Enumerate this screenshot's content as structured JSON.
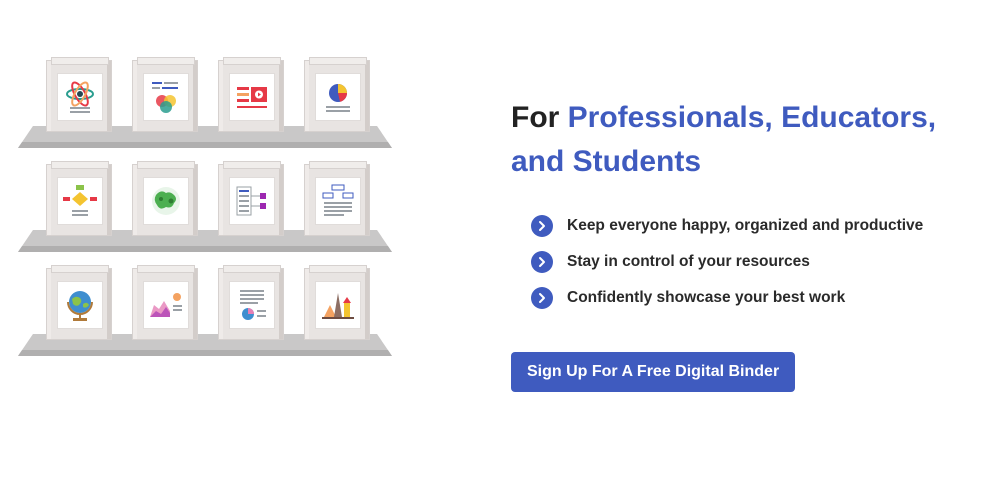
{
  "hero": {
    "headline_plain": "For",
    "headline_accent_1": "Professionals, Educators,",
    "headline_accent_2": "and Students",
    "bullets": [
      {
        "icon": "chevron-right-icon",
        "text": "Keep everyone happy, organized and productive"
      },
      {
        "icon": "chevron-right-icon",
        "text": "Stay in control of your resources"
      },
      {
        "icon": "chevron-right-icon",
        "text": "Confidently showcase your best work"
      }
    ],
    "cta_label": "Sign Up For A Free Digital Binder"
  },
  "colors": {
    "accent": "#3f5bbf",
    "text": "#222222",
    "shelf": "#c9c8c8"
  },
  "binders": [
    {
      "icon": "atom-icon"
    },
    {
      "icon": "venn-diagram-icon"
    },
    {
      "icon": "video-player-icon"
    },
    {
      "icon": "pie-chart-icon"
    },
    {
      "icon": "flowchart-icon"
    },
    {
      "icon": "world-map-icon"
    },
    {
      "icon": "org-chart-icon"
    },
    {
      "icon": "document-diagram-icon"
    },
    {
      "icon": "globe-icon"
    },
    {
      "icon": "area-chart-icon"
    },
    {
      "icon": "report-pie-icon"
    },
    {
      "icon": "landmarks-icon"
    }
  ]
}
